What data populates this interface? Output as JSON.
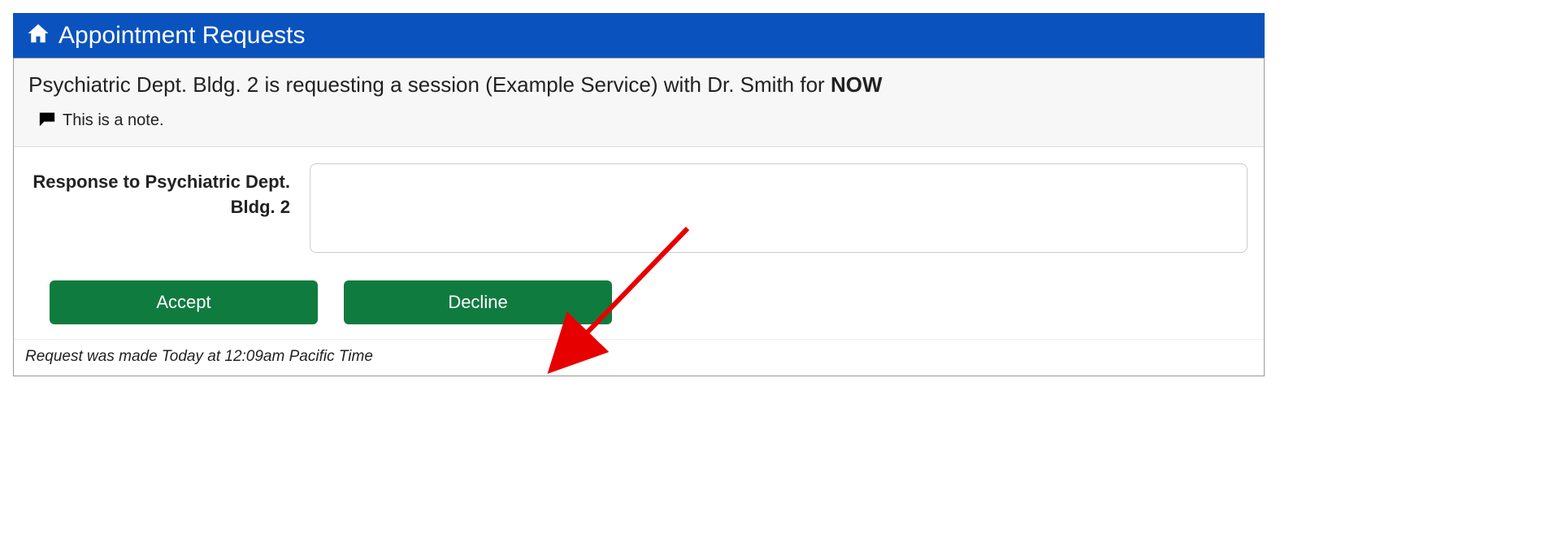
{
  "header": {
    "title": "Appointment Requests"
  },
  "request": {
    "prefix": "Psychiatric Dept. Bldg. 2 is requesting a session (Example Service) with Dr. Smith for ",
    "emphasis": "NOW",
    "note": "This is a note."
  },
  "form": {
    "response_label": "Response to Psychiatric Dept. Bldg. 2",
    "response_value": ""
  },
  "buttons": {
    "accept": "Accept",
    "decline": "Decline"
  },
  "footer": {
    "timestamp": "Request was made Today at 12:09am Pacific Time"
  }
}
